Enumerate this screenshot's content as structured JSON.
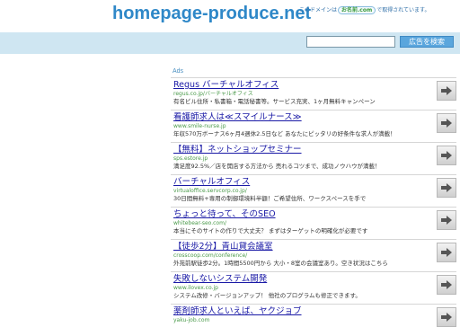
{
  "header": {
    "site_title": "homepage-produce.net",
    "domain_note_prefix": "このドメインは",
    "domain_note_brand": "お名前.com",
    "domain_note_suffix": "で取得されています。"
  },
  "search": {
    "input_value": "",
    "button_label": "広告を検索"
  },
  "ads_label": "Ads",
  "ads": [
    {
      "title": "Regus バーチャルオフィス",
      "url": "regus.co.jp/バーチャルオフィス",
      "desc": "有名ビル住所・私書箱・電話秘書等。サービス充実、1ヶ月無料キャンペーン"
    },
    {
      "title": "看護師求人は≪スマイルナース≫",
      "url": "www.smile-nurse.jp",
      "desc": "年収570万ボーナス6ヶ月4週休2.5日など あなたにピッタリの好条件な求人が満載！"
    },
    {
      "title": "【無料】ネットショップセミナー",
      "url": "sps.estore.jp",
      "desc": "満足度92.5%／店を開店する方法から 売れるコツまで、成功ノウハウが満載！"
    },
    {
      "title": "バーチャルオフィス",
      "url": "virtualoffice.servcorp.co.jp/",
      "desc": "30日間無料+専用の制御環境料半額！ご希望住所、ワークスペースを手で"
    },
    {
      "title": "ちょっと待って、そのSEO",
      "url": "whitebear-seo.com/",
      "desc": "本当にそのサイトの作りで大丈夫？ まずはターゲットの明確化が必要です"
    },
    {
      "title": "【徒歩2分】青山貸会議室",
      "url": "crosscoop.com/conference/",
      "desc": "外苑前駅徒歩2分。1時間5500円から 大小・8室の会議室あり。空き状況はこちら"
    },
    {
      "title": "失敗しないシステム開発",
      "url": "www.ilovex.co.jp",
      "desc": "システム改修・バージョンアップ！ 他社のプログラムも修正できます。"
    },
    {
      "title": "薬剤師求人といえば、ヤクジョブ",
      "url": "yaku-job.com",
      "desc": ""
    }
  ]
}
